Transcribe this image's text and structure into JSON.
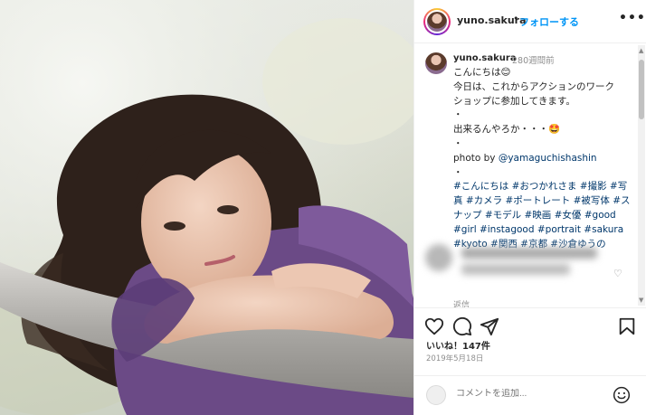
{
  "header": {
    "username": "yuno.sakura",
    "separator": "•",
    "follow_label": "フォローする",
    "more_label": "•••"
  },
  "caption": {
    "username": "yuno.sakura",
    "time": "280週間前",
    "lines": [
      "こんにちは😊",
      "今日は、これからアクションのワーク",
      "ショップに参加してきます。",
      "・",
      "出来るんやろか・・・🤩",
      "・",
      "photo by ",
      "・"
    ],
    "mention": "@yamaguchishashin",
    "hashtags": "#こんにちは #おつかれさま #撮影 #写真 #カメラ #ポートレート #被写体 #スナップ #モデル #映画 #女優 #good #girl #instagood #portrait #sakura #kyoto #関西 #京都 #沙倉ゆうの"
  },
  "reply_label": "返信",
  "likes": "いいね！147件",
  "date": "2019年5月18日",
  "comment_placeholder": "コメントを追加...",
  "icons": {
    "like": "heart-icon",
    "comment": "comment-icon",
    "share": "paper-plane-icon",
    "save": "bookmark-icon",
    "emoji": "smiley-icon"
  },
  "colors": {
    "accent": "#0095f6",
    "link": "#00376b",
    "muted": "#8e8e8e",
    "text": "#262626",
    "dress": "#6b4a86"
  }
}
